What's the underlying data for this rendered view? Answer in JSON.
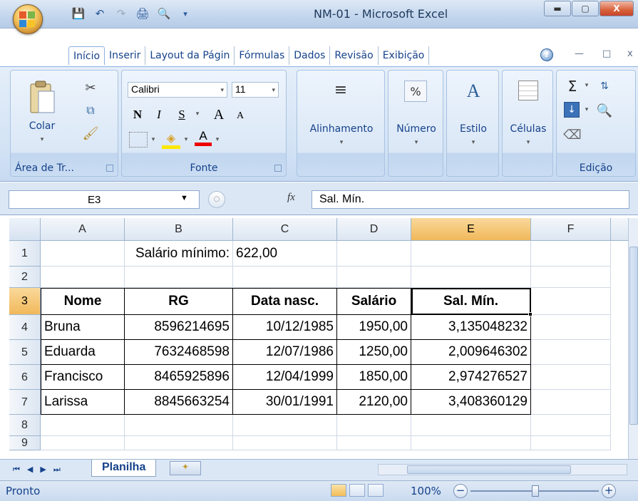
{
  "window": {
    "title": "NM-01 - Microsoft Excel"
  },
  "ribbon": {
    "tabs": [
      "Início",
      "Inserir",
      "Layout da Págin",
      "Fórmulas",
      "Dados",
      "Revisão",
      "Exibição"
    ],
    "groups": {
      "clipboard": {
        "label": "Área de Tr...",
        "paste_label": "Colar"
      },
      "font": {
        "label": "Fonte",
        "font_name": "Calibri",
        "font_size": "11"
      },
      "alignment": {
        "label": "Alinhamento"
      },
      "number": {
        "label": "Número"
      },
      "style": {
        "label": "Estilo"
      },
      "cells": {
        "label": "Células"
      },
      "editing": {
        "label": "Edição"
      }
    },
    "font_buttons": {
      "bold": "N",
      "italic": "I",
      "underline": "S",
      "grow": "A",
      "shrink": "A",
      "color": "A"
    },
    "number_icon": "%"
  },
  "formula_bar": {
    "name_box": "E3",
    "fx": "fx",
    "content": "Sal. Mín."
  },
  "grid": {
    "columns": [
      "A",
      "B",
      "C",
      "D",
      "E",
      "F"
    ],
    "rows": [
      "1",
      "2",
      "3",
      "4",
      "5",
      "6",
      "7",
      "8",
      "9"
    ],
    "selected_column": "E",
    "selected_row": "3",
    "cells": {
      "B1": "Salário mínimo:",
      "C1": "622,00",
      "A3": "Nome",
      "B3": "RG",
      "C3": "Data nasc.",
      "D3": "Salário",
      "E3": "Sal. Mín.",
      "A4": "Bruna",
      "B4": "8596214695",
      "C4": "10/12/1985",
      "D4": "1950,00",
      "E4": "3,135048232",
      "A5": "Eduarda",
      "B5": "7632468598",
      "C5": "12/07/1986",
      "D5": "1250,00",
      "E5": "2,009646302",
      "A6": "Francisco",
      "B6": "8465925896",
      "C6": "12/04/1999",
      "D6": "1850,00",
      "E6": "2,974276527",
      "A7": "Larissa",
      "B7": "8845663254",
      "C7": "30/01/1991",
      "D7": "2120,00",
      "E7": "3,408360129"
    }
  },
  "sheet_tabs": {
    "active": "Planilha"
  },
  "status_bar": {
    "status": "Pronto",
    "zoom": "100%"
  },
  "colors": {
    "accent": "#15428b",
    "selected_header": "#f1b85a",
    "ribbon_bg": "#d3e3f5"
  }
}
